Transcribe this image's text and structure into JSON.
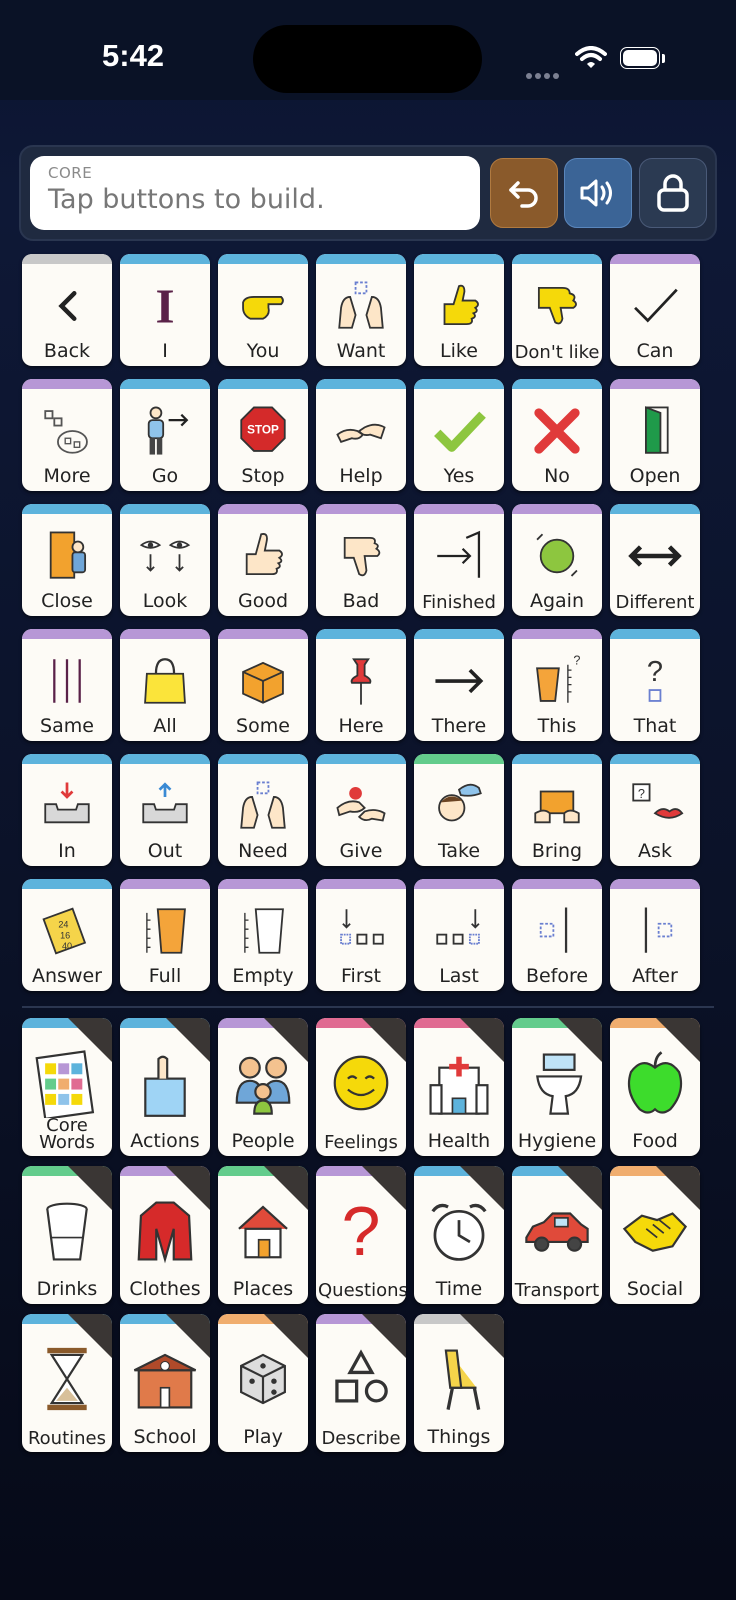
{
  "status": {
    "time": "5:42"
  },
  "message": {
    "label": "CORE",
    "placeholder": "Tap buttons to build."
  },
  "colors": {
    "blue": "#5db3dc",
    "purple": "#b797d6",
    "green": "#63cc8c",
    "pink": "#e06b92",
    "orange": "#f0ad6e",
    "undo": "#8a5a2b",
    "speak": "#3b6496",
    "lock": "#2b3a52"
  },
  "controls": {
    "undo_icon": "undo-arrow-icon",
    "speak_icon": "speaker-icon",
    "lock_icon": "lock-icon"
  },
  "core_words": [
    {
      "label": "Back",
      "icon": "chevron-left-icon",
      "color": "gray"
    },
    {
      "label": "I",
      "icon": "letter-i-icon",
      "color": "blue"
    },
    {
      "label": "You",
      "icon": "pointing-hand-icon",
      "color": "blue"
    },
    {
      "label": "Want",
      "icon": "reaching-hands-icon",
      "color": "blue"
    },
    {
      "label": "Like",
      "icon": "thumbs-up-hand-icon",
      "color": "blue"
    },
    {
      "label": "Don't like",
      "icon": "thumbs-down-hand-icon",
      "color": "blue"
    },
    {
      "label": "Can",
      "icon": "checkmark-icon",
      "color": "purple"
    },
    {
      "label": "More",
      "icon": "more-icon",
      "color": "purple"
    },
    {
      "label": "Go",
      "icon": "person-go-icon",
      "color": "blue"
    },
    {
      "label": "Stop",
      "icon": "stop-sign-icon",
      "color": "blue"
    },
    {
      "label": "Help",
      "icon": "helping-hands-icon",
      "color": "blue"
    },
    {
      "label": "Yes",
      "icon": "green-check-icon",
      "color": "blue"
    },
    {
      "label": "No",
      "icon": "red-x-icon",
      "color": "blue"
    },
    {
      "label": "Open",
      "icon": "open-door-icon",
      "color": "purple"
    },
    {
      "label": "Close",
      "icon": "close-door-icon",
      "color": "blue"
    },
    {
      "label": "Look",
      "icon": "eyes-icon",
      "color": "blue"
    },
    {
      "label": "Good",
      "icon": "thumb-up-icon",
      "color": "purple"
    },
    {
      "label": "Bad",
      "icon": "thumb-down-icon",
      "color": "purple"
    },
    {
      "label": "Finished",
      "icon": "finished-arrow-icon",
      "color": "purple"
    },
    {
      "label": "Again",
      "icon": "again-circle-icon",
      "color": "purple"
    },
    {
      "label": "Different",
      "icon": "double-arrow-icon",
      "color": "blue"
    },
    {
      "label": "Same",
      "icon": "parallel-lines-icon",
      "color": "purple"
    },
    {
      "label": "All",
      "icon": "bag-icon",
      "color": "purple"
    },
    {
      "label": "Some",
      "icon": "box-icon",
      "color": "purple"
    },
    {
      "label": "Here",
      "icon": "pin-icon",
      "color": "blue"
    },
    {
      "label": "There",
      "icon": "arrow-right-icon",
      "color": "blue"
    },
    {
      "label": "This",
      "icon": "glass-measure-icon",
      "color": "purple"
    },
    {
      "label": "That",
      "icon": "question-square-icon",
      "color": "blue"
    },
    {
      "label": "In",
      "icon": "tray-in-icon",
      "color": "blue"
    },
    {
      "label": "Out",
      "icon": "tray-out-icon",
      "color": "blue"
    },
    {
      "label": "Need",
      "icon": "reaching-hands-icon",
      "color": "blue"
    },
    {
      "label": "Give",
      "icon": "give-hands-icon",
      "color": "blue"
    },
    {
      "label": "Take",
      "icon": "take-cap-icon",
      "color": "green"
    },
    {
      "label": "Bring",
      "icon": "bring-box-icon",
      "color": "blue"
    },
    {
      "label": "Ask",
      "icon": "ask-lips-icon",
      "color": "blue"
    },
    {
      "label": "Answer",
      "icon": "answer-note-icon",
      "color": "blue"
    },
    {
      "label": "Full",
      "icon": "full-glass-icon",
      "color": "purple"
    },
    {
      "label": "Empty",
      "icon": "empty-glass-icon",
      "color": "purple"
    },
    {
      "label": "First",
      "icon": "first-squares-icon",
      "color": "purple"
    },
    {
      "label": "Last",
      "icon": "last-squares-icon",
      "color": "purple"
    },
    {
      "label": "Before",
      "icon": "before-icon",
      "color": "purple"
    },
    {
      "label": "After",
      "icon": "after-icon",
      "color": "purple"
    }
  ],
  "categories": [
    {
      "label": "Core Words",
      "icon": "board-grid-icon",
      "color": "blue"
    },
    {
      "label": "Actions",
      "icon": "actions-hand-icon",
      "color": "blue"
    },
    {
      "label": "People",
      "icon": "family-icon",
      "color": "purple"
    },
    {
      "label": "Feelings",
      "icon": "smiley-icon",
      "color": "pink"
    },
    {
      "label": "Health",
      "icon": "hospital-icon",
      "color": "pink"
    },
    {
      "label": "Hygiene",
      "icon": "toilet-icon",
      "color": "green"
    },
    {
      "label": "Food",
      "icon": "apple-icon",
      "color": "orange"
    },
    {
      "label": "Drinks",
      "icon": "drink-glass-icon",
      "color": "green"
    },
    {
      "label": "Clothes",
      "icon": "coat-icon",
      "color": "purple"
    },
    {
      "label": "Places",
      "icon": "house-icon",
      "color": "green"
    },
    {
      "label": "Questions",
      "icon": "question-mark-icon",
      "color": "purple"
    },
    {
      "label": "Time",
      "icon": "alarm-clock-icon",
      "color": "blue"
    },
    {
      "label": "Transport",
      "icon": "car-icon",
      "color": "blue"
    },
    {
      "label": "Social",
      "icon": "handshake-icon",
      "color": "orange"
    },
    {
      "label": "Routines",
      "icon": "hourglass-icon",
      "color": "blue"
    },
    {
      "label": "School",
      "icon": "school-icon",
      "color": "blue"
    },
    {
      "label": "Play",
      "icon": "dice-icon",
      "color": "orange"
    },
    {
      "label": "Describe",
      "icon": "shapes-icon",
      "color": "purple"
    },
    {
      "label": "Things",
      "icon": "chair-icon",
      "color": "gray"
    }
  ]
}
